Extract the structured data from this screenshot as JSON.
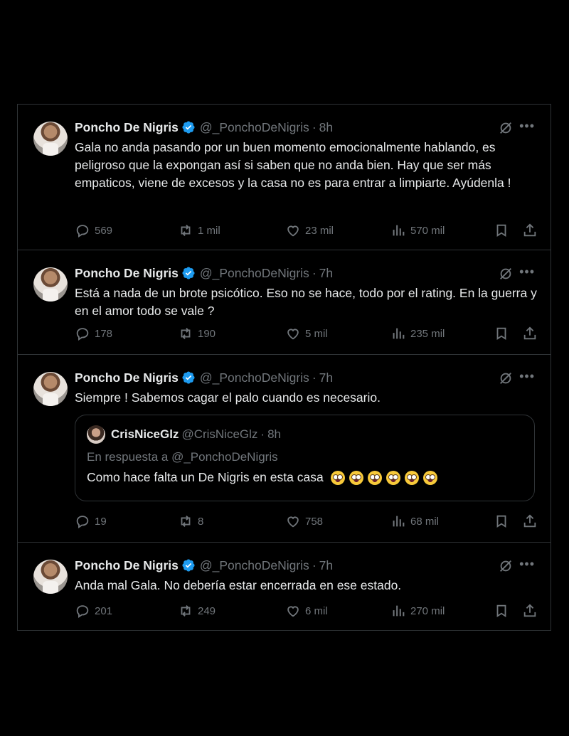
{
  "author": {
    "name": "Poncho De Nigris",
    "handle": "@_PonchoDeNigris",
    "dot": "·"
  },
  "tweets": [
    {
      "time": "8h",
      "text": "Gala no anda pasando por un buen momento emocionalmente hablando, es peligroso que la expongan así si saben que no anda bien.  Hay que ser más empaticos, viene de excesos y la casa no es para entrar a limpiarte. Ayúdenla !",
      "replies": "569",
      "retweets": "1 mil",
      "likes": "23 mil",
      "views": "570 mil"
    },
    {
      "time": "7h",
      "text": "Está a nada de un brote psicótico. Eso no se hace, todo por el rating. En la guerra y en el amor todo se vale ?",
      "replies": "178",
      "retweets": "190",
      "likes": "5 mil",
      "views": "235 mil"
    },
    {
      "time": "7h",
      "text": "Siempre ! Sabemos cagar el palo cuando es necesario.",
      "quote": {
        "name": "CrisNiceGlz",
        "handle": "@CrisNiceGlz",
        "time": "8h",
        "reply_to": "En respuesta a @_PonchoDeNigris",
        "text": "Como hace falta un De Nigris en esta casa"
      },
      "replies": "19",
      "retweets": "8",
      "likes": "758",
      "views": "68 mil"
    },
    {
      "time": "7h",
      "text": "Anda mal Gala. No debería estar encerrada en ese estado.",
      "replies": "201",
      "retweets": "249",
      "likes": "6 mil",
      "views": "270 mil"
    }
  ],
  "icons": {
    "verified": "verified-badge-icon",
    "grok": "grok-icon",
    "more": "more-icon",
    "reply": "reply-icon",
    "retweet": "retweet-icon",
    "like": "heart-icon",
    "views": "views-icon",
    "bookmark": "bookmark-icon",
    "share": "share-icon",
    "emoji": "crying-face-emoji"
  },
  "colors": {
    "background": "#000000",
    "text": "#e7e9ea",
    "muted": "#71767b",
    "border": "#2f3336",
    "verified": "#1d9bf0"
  }
}
